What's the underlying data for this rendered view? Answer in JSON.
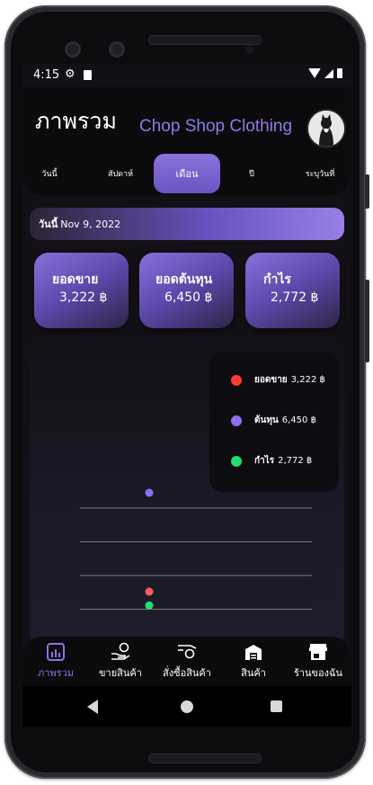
{
  "status": {
    "time": "4:15"
  },
  "header": {
    "title": "ภาพรวม",
    "shop_name": "Chop Shop Clothing"
  },
  "tabs": [
    {
      "label": "วันนี้",
      "active": false
    },
    {
      "label": "สัปดาห์",
      "active": false
    },
    {
      "label": "เดือน",
      "active": true
    },
    {
      "label": "ปี",
      "active": false
    },
    {
      "label": "ระบุวันที่",
      "active": false
    }
  ],
  "date_bar": {
    "label": "วันนี้",
    "value": "Nov 9, 2022"
  },
  "cards": [
    {
      "title": "ยอดขาย",
      "value": "3,222 ฿"
    },
    {
      "title": "ยอดต้นทุน",
      "value": "6,450 ฿"
    },
    {
      "title": "กำไร",
      "value": "2,772 ฿"
    }
  ],
  "legend": [
    {
      "label": "ยอดขาย",
      "value": "3,222 ฿",
      "color": "#ff3b3b"
    },
    {
      "label": "ต้นทุน",
      "value": "6,450 ฿",
      "color": "#8e6ff0"
    },
    {
      "label": "กำไร",
      "value": "2,772 ฿",
      "color": "#22e06f"
    }
  ],
  "chart_data": {
    "type": "scatter",
    "series": [
      {
        "name": "ยอดขาย",
        "values": [
          3222
        ],
        "color": "#ff5b5b"
      },
      {
        "name": "ต้นทุน",
        "values": [
          6450
        ],
        "color": "#8e6ff0"
      },
      {
        "name": "กำไร",
        "values": [
          2772
        ],
        "color": "#22e06f"
      }
    ],
    "gridlines": 4
  },
  "bottom_nav": [
    {
      "label": "ภาพรวม",
      "icon": "dashboard-chart-icon",
      "active": true
    },
    {
      "label": "ขายสินค้า",
      "icon": "hand-coin-icon",
      "active": false
    },
    {
      "label": "สั่งซื้อสินค้า",
      "icon": "hand-coin-order-icon",
      "active": false
    },
    {
      "label": "สินค้า",
      "icon": "warehouse-icon",
      "active": false
    },
    {
      "label": "ร้านของฉัน",
      "icon": "store-icon",
      "active": false
    }
  ]
}
